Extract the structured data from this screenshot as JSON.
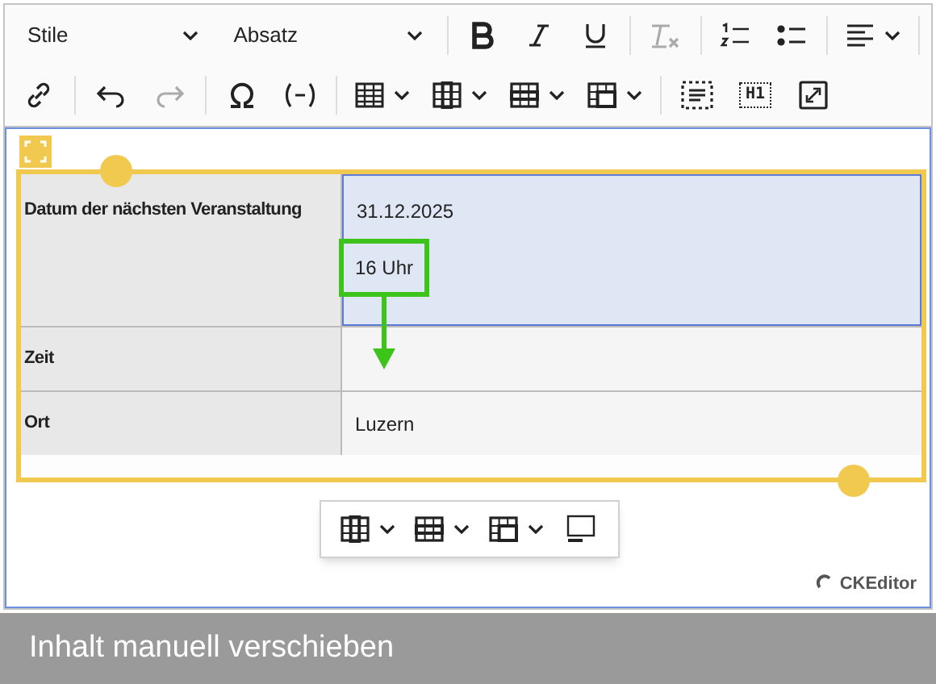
{
  "toolbar": {
    "rows": [
      [
        {
          "kind": "dropdown",
          "label": "Stile",
          "disabled": false
        },
        {
          "kind": "dropdown",
          "label": "Absatz",
          "disabled": false
        },
        {
          "kind": "separator"
        },
        {
          "kind": "button",
          "disabled": false
        },
        {
          "kind": "button",
          "disabled": false
        },
        {
          "kind": "button",
          "disabled": false
        },
        {
          "kind": "separator"
        },
        {
          "kind": "button",
          "disabled": true
        },
        {
          "kind": "separator"
        },
        {
          "kind": "button",
          "disabled": false
        },
        {
          "kind": "button",
          "disabled": false
        },
        {
          "kind": "separator"
        },
        {
          "kind": "split",
          "disabled": false
        },
        {
          "kind": "separator"
        }
      ],
      [
        {
          "kind": "button",
          "disabled": false
        },
        {
          "kind": "separator"
        },
        {
          "kind": "button",
          "disabled": false
        },
        {
          "kind": "button",
          "disabled": true
        },
        {
          "kind": "separator"
        },
        {
          "kind": "button",
          "disabled": false
        },
        {
          "kind": "button",
          "disabled": false
        },
        {
          "kind": "separator"
        },
        {
          "kind": "split",
          "disabled": false
        },
        {
          "kind": "split",
          "disabled": false
        },
        {
          "kind": "split",
          "disabled": false
        },
        {
          "kind": "split",
          "disabled": false
        },
        {
          "kind": "separator"
        },
        {
          "kind": "button",
          "disabled": false
        },
        {
          "kind": "text_button",
          "label": "H1",
          "disabled": false
        },
        {
          "kind": "button",
          "disabled": false
        }
      ]
    ]
  },
  "table": {
    "rows": [
      {
        "header": "Datum der nächsten Veranstaltung",
        "paragraphs": [
          {
            "text": "31.12.2025",
            "highlighted": false
          },
          {
            "text": "16 Uhr",
            "highlighted": true
          }
        ],
        "selected": true
      },
      {
        "header": "Zeit",
        "paragraphs": [],
        "selected": false
      },
      {
        "header": "Ort",
        "paragraphs": [
          {
            "text": "Luzern",
            "highlighted": false
          }
        ],
        "selected": false
      }
    ]
  },
  "balloon_toolbar": [
    {
      "kind": "split"
    },
    {
      "kind": "split"
    },
    {
      "kind": "split"
    },
    {
      "kind": "button"
    }
  ],
  "branding": "CKEditor",
  "caption": "Inhalt manuell verschieben"
}
